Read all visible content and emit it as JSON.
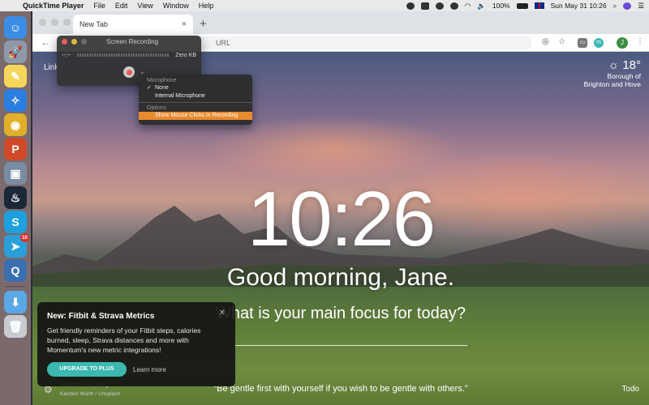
{
  "menubar": {
    "app_name": "QuickTime Player",
    "menus": [
      "File",
      "Edit",
      "View",
      "Window",
      "Help"
    ],
    "battery": "100%",
    "datetime": "Sun May 31  10:26"
  },
  "dock": {
    "items": [
      {
        "name": "finder",
        "glyph": "☺",
        "color": "#3a8ee6"
      },
      {
        "name": "launchpad",
        "glyph": "🚀",
        "color": "#8f9aa8"
      },
      {
        "name": "notes",
        "glyph": "✎",
        "color": "#f5d65a"
      },
      {
        "name": "safari",
        "glyph": "✧",
        "color": "#2a7ee0"
      },
      {
        "name": "chrome",
        "glyph": "◉",
        "color": "#e0b02a"
      },
      {
        "name": "powerpoint",
        "glyph": "P",
        "color": "#d04a2a"
      },
      {
        "name": "preview",
        "glyph": "▣",
        "color": "#7a8ca0"
      },
      {
        "name": "steam",
        "glyph": "♨",
        "color": "#1b2838"
      },
      {
        "name": "skype",
        "glyph": "S",
        "color": "#1ea0e0"
      },
      {
        "name": "telegram",
        "glyph": "➤",
        "color": "#2aa0da",
        "badge": "10"
      },
      {
        "name": "quicktime",
        "glyph": "Q",
        "color": "#3c6fb0"
      },
      {
        "name": "downloads",
        "glyph": "⬇",
        "color": "#5aa8e6"
      },
      {
        "name": "trash",
        "glyph": "🗑",
        "color": "#c8ccd0"
      }
    ]
  },
  "browser": {
    "tab_title": "New Tab",
    "omnibox_placeholder": "URL",
    "profile_initial": "J"
  },
  "momentum": {
    "links_label": "Link",
    "weather": {
      "temp": "18°",
      "location_line1": "Borough of",
      "location_line2": "Brighton and Hove"
    },
    "clock": "10:26",
    "greeting": "Good morning, Jane.",
    "focus_prompt": "What is your main focus for today?",
    "quote": "“Be gentle first with yourself if you wish to be gentle with others.”",
    "todo_label": "Todo",
    "photo_place": "Seiser Alm, Italy",
    "photo_credit": "Karsten Würth / Unsplash"
  },
  "promo": {
    "title": "New: Fitbit & Strava Metrics",
    "body": "Get friendly reminders of your Fitbit steps, calories burned, sleep, Strava distances and more with Momentum's new metric integrations!",
    "cta": "UPGRADE TO PLUS",
    "learn_more": "Learn more"
  },
  "screen_recording": {
    "title": "Screen Recording",
    "time": "--:--",
    "size": "Zero KB"
  },
  "options_menu": {
    "microphone_header": "Microphone",
    "none": "None",
    "internal_mic": "Internal Microphone",
    "options_header": "Options",
    "mouse_clicks": "Show Mouse Clicks in Recording"
  }
}
